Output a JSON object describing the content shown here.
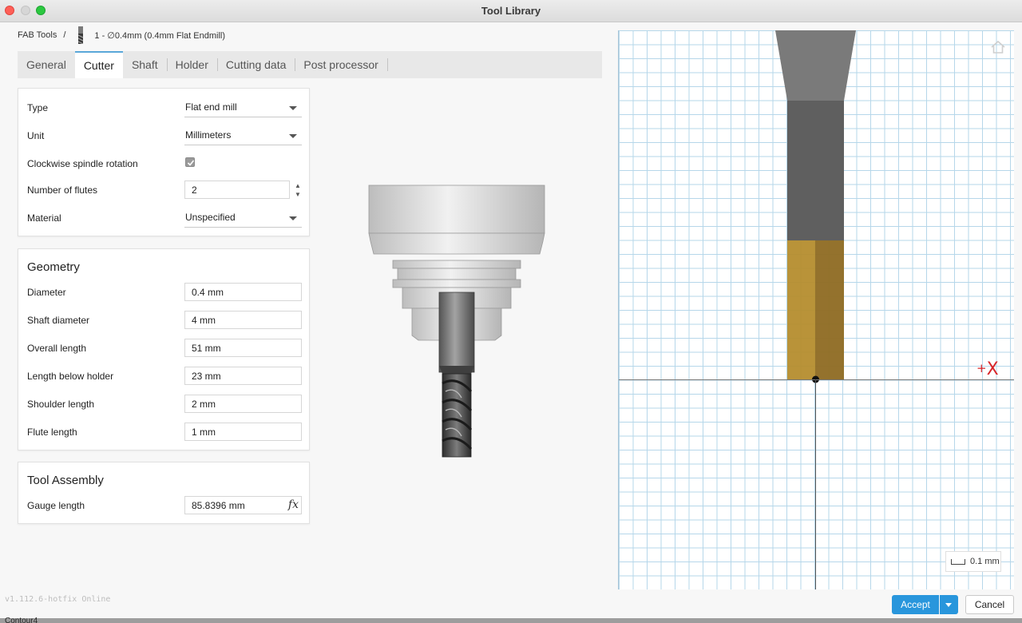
{
  "window": {
    "title": "Tool Library"
  },
  "breadcrumb": {
    "library": "FAB Tools",
    "separator": "/",
    "tool": "1 - ∅0.4mm (0.4mm Flat Endmill)"
  },
  "tabs": [
    {
      "label": "General",
      "active": false
    },
    {
      "label": "Cutter",
      "active": true
    },
    {
      "label": "Shaft",
      "active": false
    },
    {
      "label": "Holder",
      "active": false
    },
    {
      "label": "Cutting data",
      "active": false
    },
    {
      "label": "Post processor",
      "active": false
    }
  ],
  "cutter": {
    "type": {
      "label": "Type",
      "value": "Flat end mill"
    },
    "unit": {
      "label": "Unit",
      "value": "Millimeters"
    },
    "clockwise": {
      "label": "Clockwise spindle rotation",
      "checked": true
    },
    "flutes": {
      "label": "Number of flutes",
      "value": "2"
    },
    "material": {
      "label": "Material",
      "value": "Unspecified"
    }
  },
  "geometry": {
    "title": "Geometry",
    "diameter": {
      "label": "Diameter",
      "value": "0.4 mm"
    },
    "shaft_diameter": {
      "label": "Shaft diameter",
      "value": "4 mm"
    },
    "overall_length": {
      "label": "Overall length",
      "value": "51 mm"
    },
    "length_below_holder": {
      "label": "Length below holder",
      "value": "23 mm"
    },
    "shoulder_length": {
      "label": "Shoulder length",
      "value": "2 mm"
    },
    "flute_length": {
      "label": "Flute length",
      "value": "1 mm"
    }
  },
  "assembly": {
    "title": "Tool Assembly",
    "gauge_length": {
      "label": "Gauge length",
      "value": "85.8396 mm",
      "formula_symbol": "fx"
    }
  },
  "viewport": {
    "axis_label_sign": "+",
    "axis_label": "X",
    "scale_label": "0.1 mm",
    "colors": {
      "grid": "#b6d7ea",
      "shank": "#5f5f5f",
      "flute": "#b58d2e",
      "axis_label": "#d8262a"
    }
  },
  "footer": {
    "version": "v1.112.6-hotfix Online",
    "bottom_text": "Contour4",
    "accept_label": "Accept",
    "cancel_label": "Cancel"
  },
  "icons": {
    "home": "home-icon",
    "dropdown": "chevron-down-icon",
    "check": "checkmark-icon",
    "stepper": "stepper-arrows-icon"
  }
}
